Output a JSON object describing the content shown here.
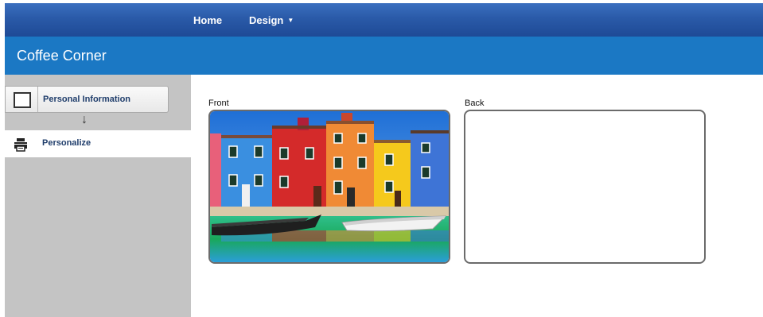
{
  "nav": {
    "home": "Home",
    "design": "Design"
  },
  "app": {
    "title": "Coffee Corner"
  },
  "steps": [
    {
      "label": "Personal Information",
      "icon": "blank-square-icon"
    },
    {
      "label": "Personalize",
      "icon": "printer-icon"
    }
  ],
  "design": {
    "front_label": "Front",
    "back_label": "Back"
  },
  "colors": {
    "nav": "#2a5aa8",
    "titlebar": "#1b78c4",
    "sidebar": "#c4c4c4",
    "step_label": "#1f3d6b"
  }
}
